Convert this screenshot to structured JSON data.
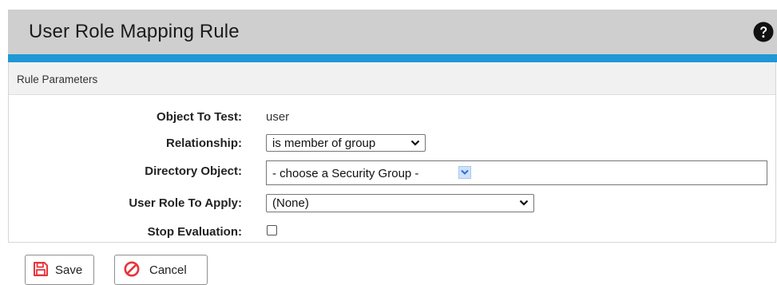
{
  "header": {
    "title": "User Role Mapping Rule",
    "help_icon": "question-circle-icon"
  },
  "section": {
    "title": "Rule Parameters"
  },
  "form": {
    "object_to_test": {
      "label": "Object To Test:",
      "value": "user"
    },
    "relationship": {
      "label": "Relationship:",
      "selected": "is member of group"
    },
    "directory_object": {
      "label": "Directory Object:",
      "value": "- choose a Security Group -"
    },
    "user_role": {
      "label": "User Role To Apply:",
      "selected": "(None)"
    },
    "stop_evaluation": {
      "label": "Stop Evaluation:",
      "checked": false
    }
  },
  "buttons": {
    "save": {
      "label": "Save",
      "icon": "floppy-disk-icon"
    },
    "cancel": {
      "label": "Cancel",
      "icon": "cancel-circle-icon"
    }
  },
  "colors": {
    "header_bg": "#cfcfcf",
    "accent_bar": "#1f98d5",
    "section_bg": "#f1f1f1",
    "icon_red": "#e8343a"
  }
}
